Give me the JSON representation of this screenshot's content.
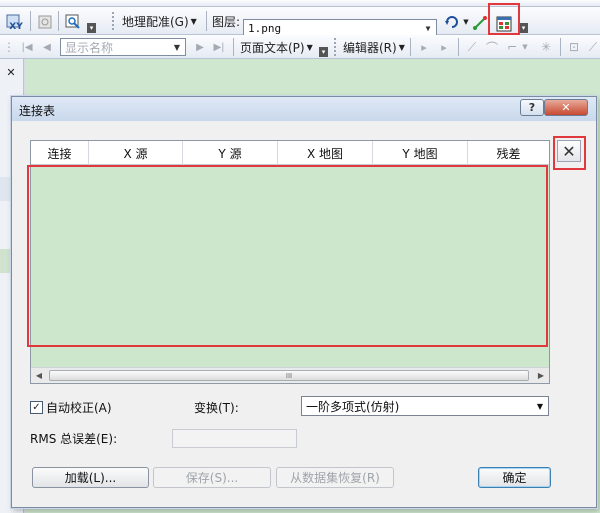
{
  "toolbar_georef": {
    "xy_label": "XY",
    "georef_menu": "地理配准(G)",
    "layer_label": "图层:",
    "layer_value": "1.png"
  },
  "toolbar_layout": {
    "display_name_placeholder": "显示名称",
    "page_text_menu": "页面文本(P)",
    "editor_menu": "编辑器(R)"
  },
  "left_strip": {
    "close_glyph": "✕"
  },
  "dialog": {
    "title": "连接表",
    "help_glyph": "?",
    "close_glyph": "✕",
    "columns": [
      "连接",
      "X 源",
      "Y 源",
      "X 地图",
      "Y 地图",
      "残差"
    ],
    "scroll_thumb_label": "III",
    "auto_adjust_label": "自动校正(A)",
    "auto_adjust_checked": true,
    "transform_label": "变换(T):",
    "transform_value": "一阶多项式(仿射)",
    "rms_label": "RMS 总误差(E):",
    "rms_value": "",
    "load_button": "加载(L)...",
    "save_button": "保存(S)...",
    "restore_button": "从数据集恢复(R)",
    "ok_button": "确定",
    "delete_link_glyph": "✕"
  },
  "colors": {
    "highlight": "#e0383d",
    "map_background": "#cfe7cf"
  }
}
